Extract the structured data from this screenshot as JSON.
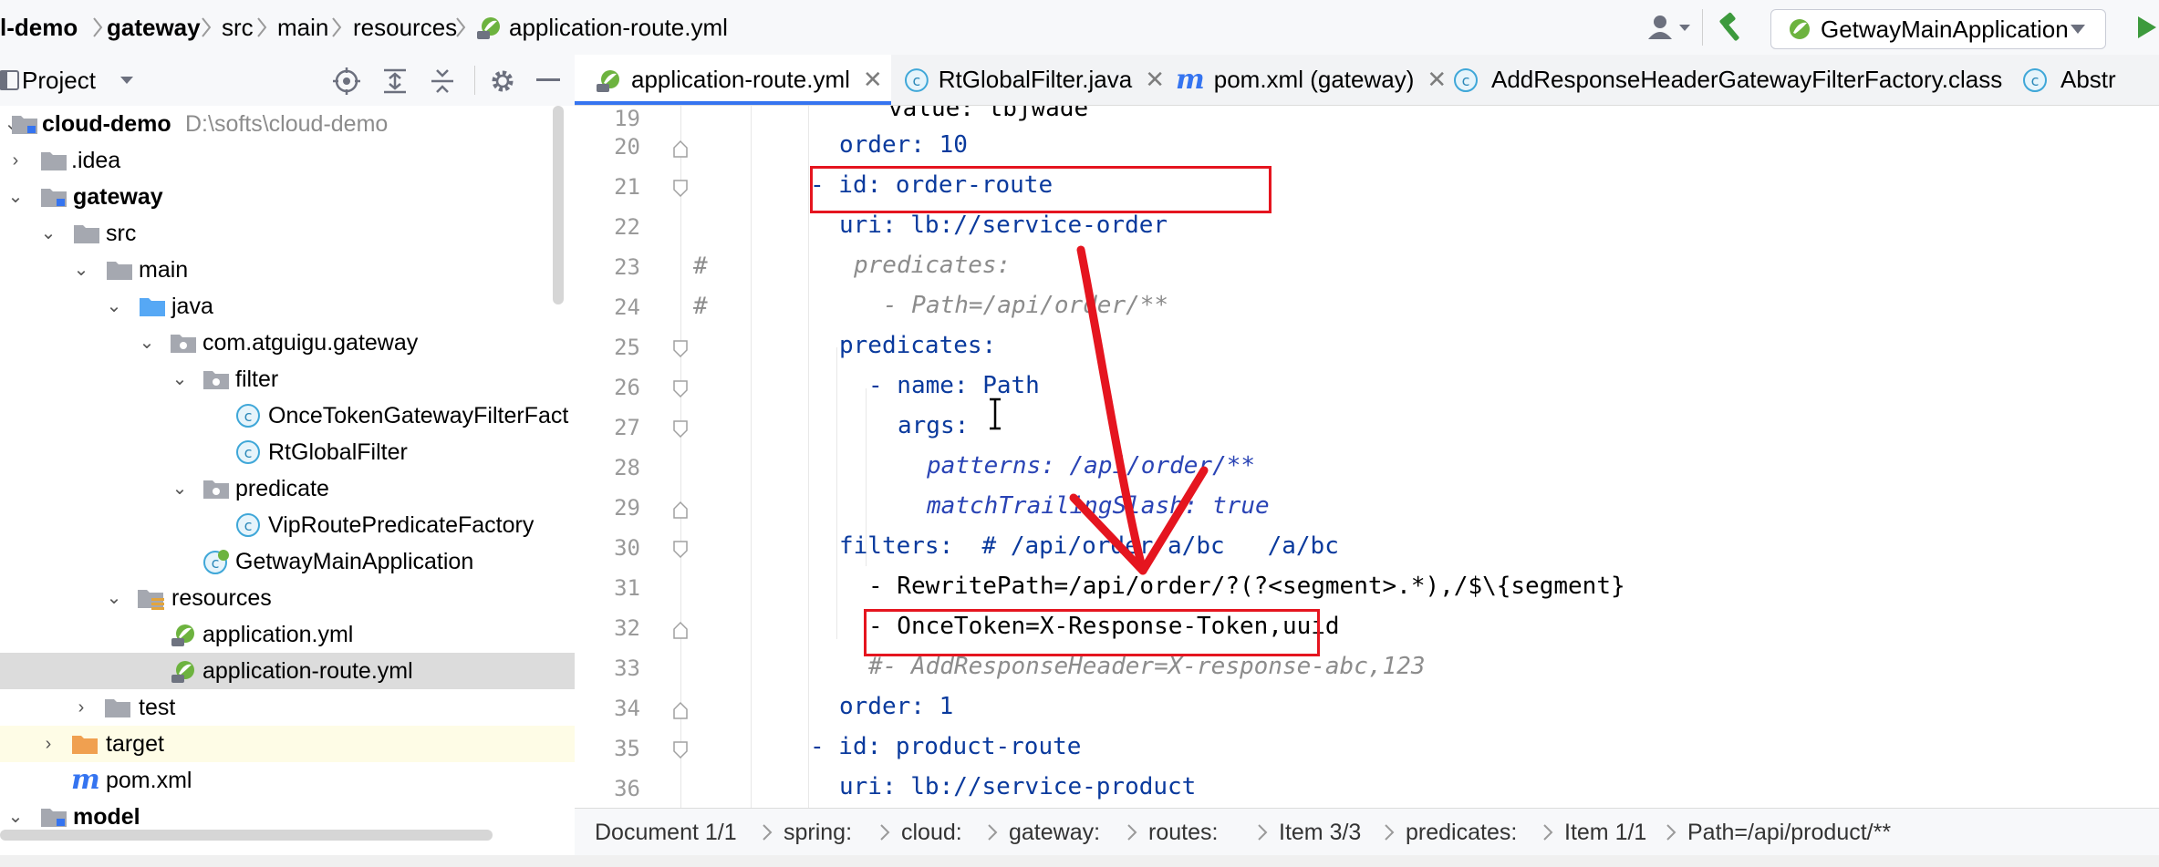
{
  "breadcrumb": {
    "items": [
      "l-demo",
      "gateway",
      "src",
      "main",
      "resources",
      "application-route.yml"
    ]
  },
  "toolbar": {
    "run_config": "GetwayMainApplication",
    "icons": [
      "user-icon",
      "hammer-icon",
      "spring-icon",
      "dropdown-icon",
      "run-icon"
    ]
  },
  "project_panel": {
    "title": "Project",
    "icons": [
      "target-icon",
      "expand-icon",
      "collapse-icon",
      "gear-icon",
      "minimize-icon"
    ]
  },
  "tabs": [
    {
      "label": "application-route.yml",
      "icon": "spring-yml-icon",
      "active": true,
      "closable": true
    },
    {
      "label": "RtGlobalFilter.java",
      "icon": "class-icon",
      "active": false,
      "closable": true
    },
    {
      "label": "pom.xml (gateway)",
      "icon": "maven-icon",
      "active": false,
      "closable": true
    },
    {
      "label": "AddResponseHeaderGatewayFilterFactory.class",
      "icon": "class-icon",
      "active": false,
      "closable": false
    },
    {
      "label": "Abstr",
      "icon": "class-icon",
      "active": false,
      "closable": false
    }
  ],
  "tree": [
    {
      "label": "cloud-demo",
      "hint": "D:\\softs\\cloud-demo",
      "icon": "module-folder-icon",
      "expanded": true,
      "bold": true
    },
    {
      "label": ".idea",
      "icon": "folder-icon",
      "expanded": false
    },
    {
      "label": "gateway",
      "icon": "module-folder-icon",
      "expanded": true,
      "bold": true
    },
    {
      "label": "src",
      "icon": "folder-icon",
      "expanded": true
    },
    {
      "label": "main",
      "icon": "folder-icon",
      "expanded": true
    },
    {
      "label": "java",
      "icon": "source-folder-icon",
      "expanded": true
    },
    {
      "label": "com.atguigu.gateway",
      "icon": "package-icon",
      "expanded": true
    },
    {
      "label": "filter",
      "icon": "package-icon",
      "expanded": true
    },
    {
      "label": "OnceTokenGatewayFilterFact",
      "icon": "class-icon"
    },
    {
      "label": "RtGlobalFilter",
      "icon": "class-icon"
    },
    {
      "label": "predicate",
      "icon": "package-icon",
      "expanded": true
    },
    {
      "label": "VipRoutePredicateFactory",
      "icon": "class-icon"
    },
    {
      "label": "GetwayMainApplication",
      "icon": "spring-class-icon"
    },
    {
      "label": "resources",
      "icon": "resources-folder-icon",
      "expanded": true
    },
    {
      "label": "application.yml",
      "icon": "spring-yml-icon"
    },
    {
      "label": "application-route.yml",
      "icon": "spring-yml-icon",
      "selected": true
    },
    {
      "label": "test",
      "icon": "folder-icon",
      "expanded": false
    },
    {
      "label": "target",
      "icon": "excluded-folder-icon",
      "expanded": false,
      "highlight": true
    },
    {
      "label": "pom.xml",
      "icon": "maven-icon"
    },
    {
      "label": "model",
      "icon": "module-folder-icon",
      "expanded": true,
      "bold": true
    }
  ],
  "editor": {
    "lines": [
      {
        "num": "19",
        "text": "value: tbjwade"
      },
      {
        "num": "20",
        "text": "order: 10"
      },
      {
        "num": "21",
        "text": "- id: order-route"
      },
      {
        "num": "22",
        "text": "uri: lb://service-order"
      },
      {
        "num": "23",
        "marker": "#",
        "text": "predicates:"
      },
      {
        "num": "24",
        "marker": "#",
        "text": "- Path=/api/order/**"
      },
      {
        "num": "25",
        "text": "predicates:"
      },
      {
        "num": "26",
        "text": "- name: Path"
      },
      {
        "num": "27",
        "text": "args:"
      },
      {
        "num": "28",
        "text": "patterns: /api/order/**"
      },
      {
        "num": "29",
        "text": "matchTrailingSlash: true"
      },
      {
        "num": "30",
        "text": "filters:  # /api/order/a/bc   /a/bc"
      },
      {
        "num": "31",
        "text": "- RewritePath=/api/order/?(?<segment>.*),/$\\{segment}"
      },
      {
        "num": "32",
        "text": "- OnceToken=X-Response-Token,uuid"
      },
      {
        "num": "33",
        "text": "#- AddResponseHeader=X-response-abc,123"
      },
      {
        "num": "34",
        "text": "order: 1"
      },
      {
        "num": "35",
        "text": "- id: product-route"
      },
      {
        "num": "36",
        "text": "uri: lb://service-product"
      }
    ]
  },
  "statusbar": {
    "items": [
      "Document 1/1",
      "spring:",
      "cloud:",
      "gateway:",
      "routes:",
      "Item 3/3",
      "predicates:",
      "Item 1/1",
      "Path=/api/product/**"
    ]
  },
  "colors": {
    "annotation_red": "#e5151f",
    "tab_underline": "#3574f0",
    "selection": "#dcdcdc",
    "key_blue": "#0a3a9d"
  }
}
